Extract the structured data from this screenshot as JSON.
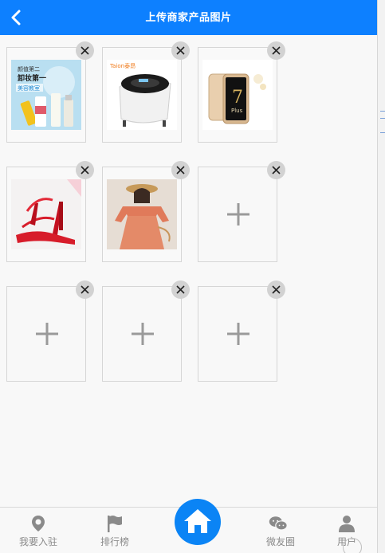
{
  "header": {
    "title": "上传商家产品图片",
    "back_icon": "chevron-left-icon",
    "bg_color": "#0d80ff"
  },
  "tiles": [
    {
      "type": "image",
      "image_text": [
        "颜值第二",
        "卸妆第一",
        "美容教室"
      ],
      "description": "cosmetics-product-photo"
    },
    {
      "type": "image",
      "brand": "Taion泰昂",
      "description": "foot-spa-basin-photo"
    },
    {
      "type": "image",
      "badge": "7",
      "badge_sub": "Plus",
      "description": "gold-smartphone-photo"
    },
    {
      "type": "image",
      "description": "red-high-heel-sandals-photo"
    },
    {
      "type": "image",
      "description": "orange-off-shoulder-dress-photo"
    },
    {
      "type": "add",
      "icon": "plus-icon"
    },
    {
      "type": "add",
      "icon": "plus-icon"
    },
    {
      "type": "add",
      "icon": "plus-icon"
    },
    {
      "type": "add",
      "icon": "plus-icon"
    }
  ],
  "bottom_nav": [
    {
      "label": "我要入驻",
      "icon": "location-pin-icon"
    },
    {
      "label": "排行榜",
      "icon": "flag-icon"
    },
    {
      "label": "",
      "icon": "home-icon"
    },
    {
      "label": "微友圈",
      "icon": "wechat-icon"
    },
    {
      "label": "用户",
      "icon": "user-icon"
    }
  ],
  "colors": {
    "accent": "#0d80ff",
    "home_button": "#0b84f5",
    "close_bg": "#d2d2d2",
    "nav_text": "#8a8a8a"
  }
}
